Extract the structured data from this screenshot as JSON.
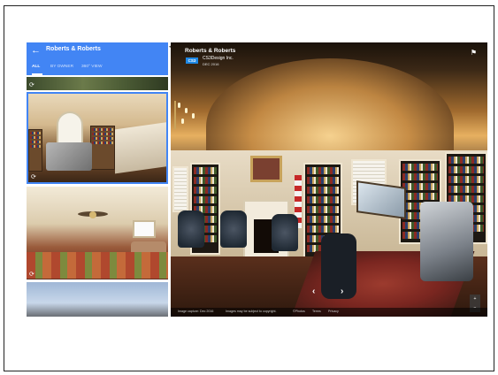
{
  "sidebar": {
    "back_glyph": "←",
    "title": "Roberts & Roberts",
    "tabs": [
      {
        "label": "ALL",
        "active": true
      },
      {
        "label": "BY OWNER",
        "active": false
      },
      {
        "label": "360° VIEW",
        "active": false
      }
    ],
    "pano_glyph": "⟳",
    "collapse_glyph": "◂"
  },
  "viewer": {
    "title": "Roberts & Roberts",
    "logo_text": "CS3",
    "company": "CS3Design Inc.",
    "date": "DEC 2016",
    "flag_glyph": "⚑",
    "prev_glyph": "‹",
    "next_glyph": "›",
    "zoom_in": "+",
    "zoom_out": "−"
  },
  "footer": {
    "capture": "Image capture: Dec 2016",
    "copyright": "Images may be subject to copyright.",
    "brand": "©Photos",
    "terms": "Terms",
    "privacy": "Privacy"
  },
  "colors": {
    "accent": "#4285f4"
  },
  "icons": [
    "back-arrow-icon",
    "panorama-icon",
    "flag-icon",
    "chevron-left-icon",
    "chevron-right-icon",
    "collapse-icon"
  ]
}
